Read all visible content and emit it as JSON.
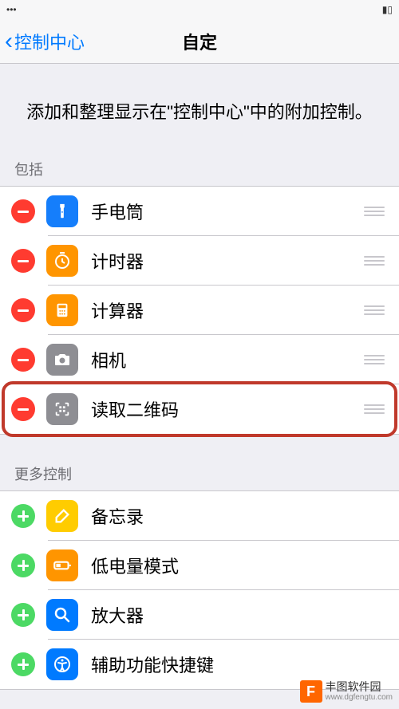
{
  "nav": {
    "back_label": "控制中心",
    "title": "自定"
  },
  "description": "添加和整理显示在\"控制中心\"中的附加控制。",
  "sections": {
    "included_header": "包括",
    "more_header": "更多控制"
  },
  "included": [
    {
      "label": "手电筒",
      "icon_bg": "#157efb",
      "icon_name": "flashlight-icon"
    },
    {
      "label": "计时器",
      "icon_bg": "#ff9500",
      "icon_name": "timer-icon"
    },
    {
      "label": "计算器",
      "icon_bg": "#ff9500",
      "icon_name": "calculator-icon"
    },
    {
      "label": "相机",
      "icon_bg": "#8e8e93",
      "icon_name": "camera-icon"
    },
    {
      "label": "读取二维码",
      "icon_bg": "#8e8e93",
      "icon_name": "qr-icon"
    }
  ],
  "more": [
    {
      "label": "备忘录",
      "icon_bg": "#ffcc00",
      "icon_name": "notes-icon"
    },
    {
      "label": "低电量模式",
      "icon_bg": "#ff9500",
      "icon_name": "battery-icon"
    },
    {
      "label": "放大器",
      "icon_bg": "#007aff",
      "icon_name": "magnifier-icon"
    },
    {
      "label": "辅助功能快捷键",
      "icon_bg": "#007aff",
      "icon_name": "accessibility-icon"
    }
  ],
  "watermark": {
    "logo_letter": "F",
    "title": "丰图软件园",
    "url": "www.dgfengtu.com"
  },
  "highlight_index": 4
}
